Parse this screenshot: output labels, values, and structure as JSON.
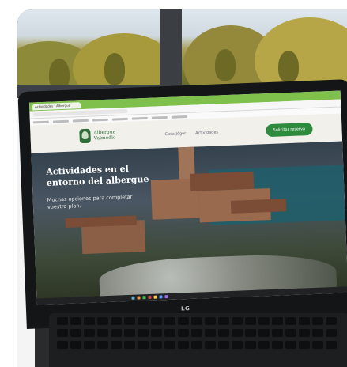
{
  "browser": {
    "tab_title": "Actividades | Albergue"
  },
  "site": {
    "logo_line1": "Albergue",
    "logo_line2": "Valmedio",
    "nav": [
      "Casa Jóger",
      "Actividades"
    ],
    "cta_label": "Solicitar reserva"
  },
  "hero": {
    "title": "Actividades en el entorno del albergue",
    "subtitle": "Muchas opciones para completar vuestro plan."
  },
  "laptop": {
    "brand": "LG"
  }
}
